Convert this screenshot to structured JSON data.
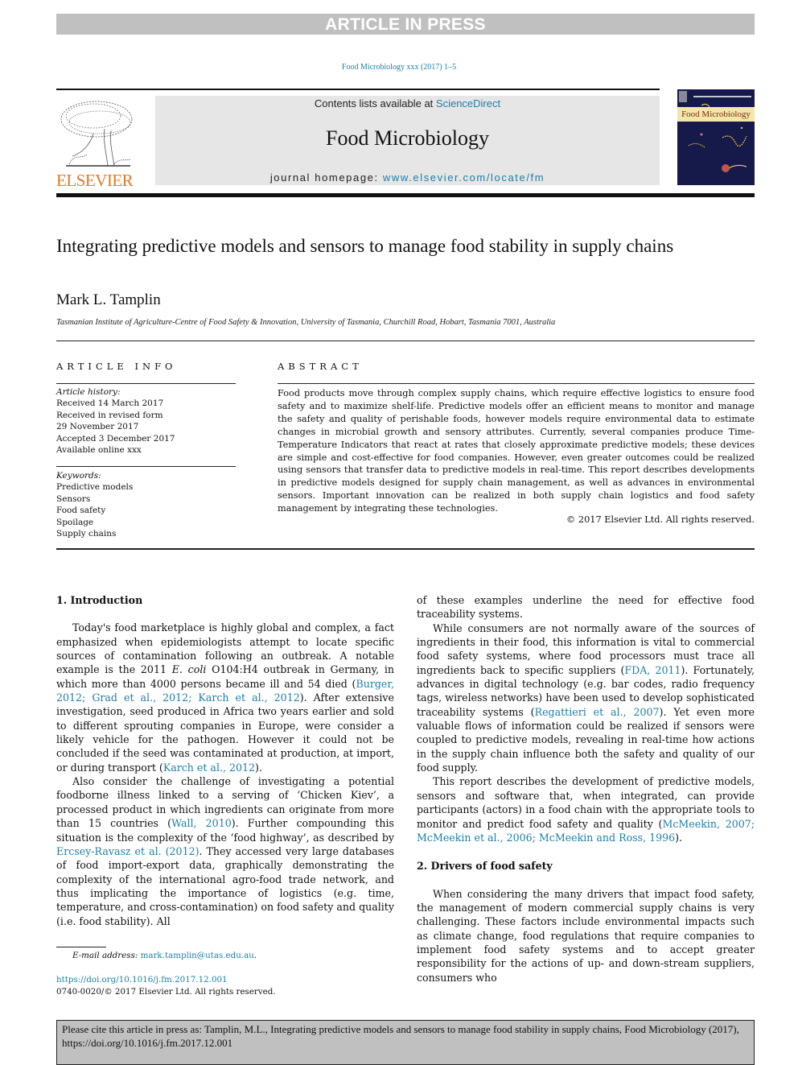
{
  "banner": "ARTICLE IN PRESS",
  "journal_ref": "Food Microbiology xxx (2017) 1–5",
  "masthead": {
    "publisher": "ELSEVIER",
    "contents_prefix": "Contents lists available at ",
    "contents_link": "ScienceDirect",
    "journal_name": "Food Microbiology",
    "homepage_prefix": "journal homepage: ",
    "homepage_link": "www.elsevier.com/locate/fm",
    "cover_title": "Food Microbiology"
  },
  "article": {
    "title": "Integrating predictive models and sensors to manage food stability in supply chains",
    "author": "Mark L. Tamplin",
    "affiliation": "Tasmanian Institute of Agriculture-Centre of Food Safety & Innovation, University of Tasmania, Churchill Road, Hobart, Tasmania 7001, Australia"
  },
  "article_info": {
    "heading": "ARTICLE INFO",
    "history_label": "Article history:",
    "history": [
      "Received 14 March 2017",
      "Received in revised form",
      "29 November 2017",
      "Accepted 3 December 2017",
      "Available online xxx"
    ],
    "keywords_label": "Keywords:",
    "keywords": [
      "Predictive models",
      "Sensors",
      "Food safety",
      "Spoilage",
      "Supply chains"
    ]
  },
  "abstract": {
    "heading": "ABSTRACT",
    "text": "Food products move through complex supply chains, which require effective logistics to ensure food safety and to maximize shelf-life. Predictive models offer an efficient means to monitor and manage the safety and quality of perishable foods, however models require environmental data to estimate changes in microbial growth and sensory attributes. Currently, several companies produce Time-Temperature Indicators that react at rates that closely approximate predictive models; these devices are simple and cost-effective for food companies. However, even greater outcomes could be realized using sensors that transfer data to predictive models in real-time. This report describes developments in predictive models designed for supply chain management, as well as advances in environmental sensors. Important innovation can be realized in both supply chain logistics and food safety management by integrating these technologies.",
    "copyright": "© 2017 Elsevier Ltd. All rights reserved."
  },
  "body": {
    "section1_heading": "1.  Introduction",
    "p1_a": "Today's food marketplace is highly global and complex, a fact emphasized when epidemiologists attempt to locate specific sources of contamination following an outbreak. A notable example is the 2011 ",
    "p1_ecoli": "E. coli",
    "p1_b": " O104:H4 outbreak in Germany, in which more than 4000 persons became ill and 54 died (",
    "p1_ref1": "Burger, 2012; Grad et al., 2012; Karch et al., 2012",
    "p1_c": "). After extensive investigation, seed produced in Africa two years earlier and sold to different sprouting companies in Europe, were consider a likely vehicle for the pathogen. However it could not be concluded if the seed was contaminated at production, at import, or during transport (",
    "p1_ref2": "Karch et al., 2012",
    "p1_d": ").",
    "p2_a": "Also consider the challenge of investigating a potential foodborne illness linked to a serving of ‘Chicken Kiev’, a processed product in which ingredients can originate from more than 15 countries (",
    "p2_ref1": "Wall, 2010",
    "p2_b": "). Further compounding this situation is the complexity of the ‘food highway’, as described by ",
    "p2_ref2": "Ercsey-Ravasz et al. (2012)",
    "p2_c": ". They accessed very large databases of food import-export data, graphically demonstrating the complexity of the international agro-food trade network, and thus implicating the importance of logistics (e.g. time, temperature, and cross-contamination) on food safety and quality (i.e. food stability). All of these examples underline the need for effective food traceability systems.",
    "p3_a": "While consumers are not normally aware of the sources of ingredients in their food, this information is vital to commercial food safety systems, where food processors must trace all ingredients back to specific suppliers (",
    "p3_ref1": "FDA, 2011",
    "p3_b": "). Fortunately, advances in digital technology (e.g. bar codes, radio frequency tags, wireless networks) have been used to develop sophisticated traceability systems (",
    "p3_ref2": "Regattieri et al., 2007",
    "p3_c": "). Yet even more valuable flows of information could be realized if sensors were coupled to predictive models, revealing in real-time how actions in the supply chain influence both the safety and quality of our food supply.",
    "p4_a": "This report describes the development of predictive models, sensors and software that, when integrated, can provide participants (actors) in a food chain with the appropriate tools to monitor and predict food safety and quality (",
    "p4_ref": "McMeekin, 2007; McMeekin et al., 2006; McMeekin and Ross, 1996",
    "p4_b": ").",
    "section2_heading": "2.  Drivers of food safety",
    "p5": "When considering the many drivers that impact food safety, the management of modern commercial supply chains is very challenging. These factors include environmental impacts such as climate change, food regulations that require companies to implement food safety systems and to accept greater responsibility for the actions of up- and down-stream suppliers, consumers who"
  },
  "footer": {
    "email_label": "E-mail address:",
    "email": "mark.tamplin@utas.edu.au",
    "email_suffix": ".",
    "doi": "https://doi.org/10.1016/j.fm.2017.12.001",
    "issn": "0740-0020/© 2017 Elsevier Ltd. All rights reserved.",
    "cite_notice": "Please cite this article in press as: Tamplin, M.L., Integrating predictive models and sensors to manage food stability in supply chains, Food Microbiology (2017), https://doi.org/10.1016/j.fm.2017.12.001"
  },
  "colors": {
    "link": "#1b7fa8",
    "elsevier_orange": "#e87722",
    "banner_gray": "#c0c0c0",
    "masthead_gray": "#e6e6e6"
  }
}
